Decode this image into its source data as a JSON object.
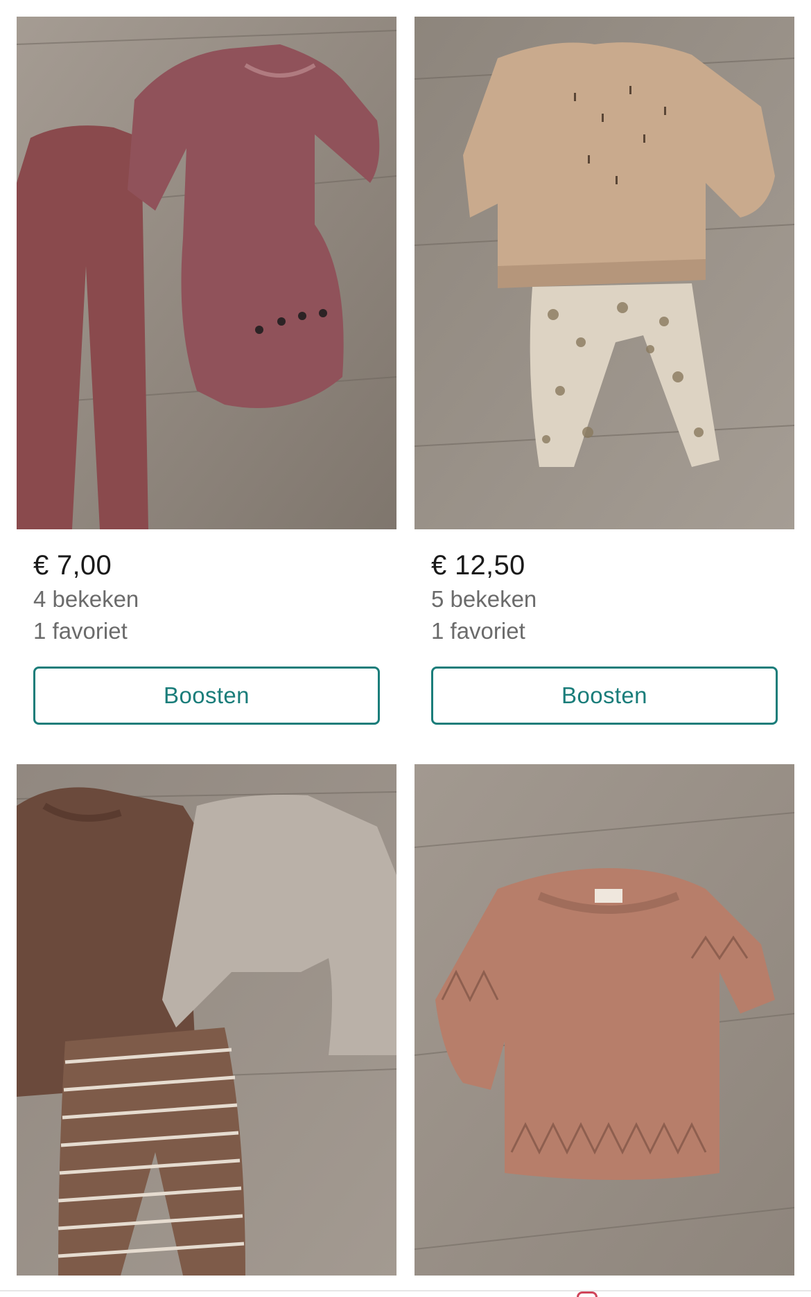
{
  "listings": [
    {
      "photo_alt": "Roze ribbed body met legging",
      "price": "€ 7,00",
      "views": "4 bekeken",
      "favorites": "1 favoriet",
      "boost_label": "Boosten"
    },
    {
      "photo_alt": "Beige gebreide trui met bloemenlegging",
      "price": "€ 12,50",
      "views": "5 bekeken",
      "favorites": "1 favoriet",
      "boost_label": "Boosten"
    },
    {
      "photo_alt": "Bruine jurk, grijs shirt en gestreepte broek"
    },
    {
      "photo_alt": "Roze gebreide trui met ajourpatroon"
    }
  ],
  "colors": {
    "accent": "#1a7d7a",
    "floor": "#9b9289",
    "price_text": "#1a1a1a",
    "meta_text": "#6b6b6b"
  }
}
